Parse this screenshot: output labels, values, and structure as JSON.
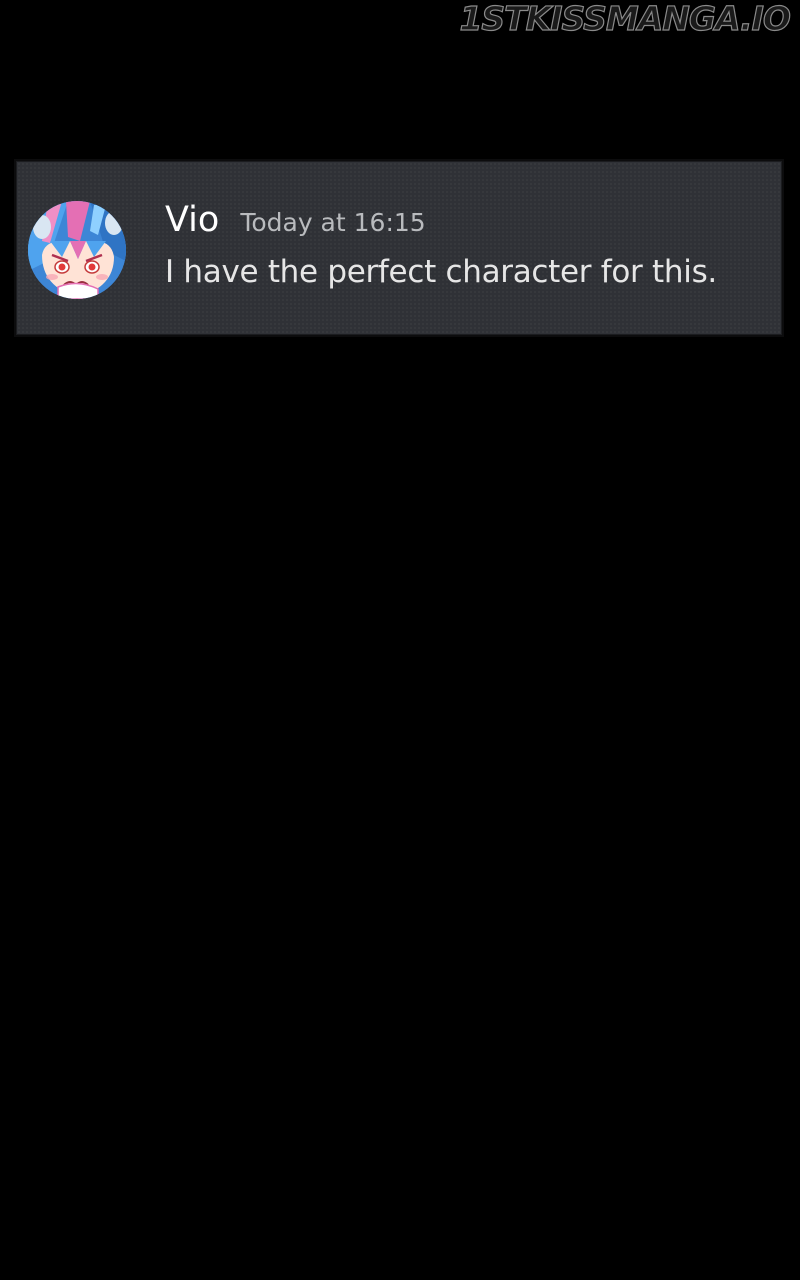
{
  "watermark": {
    "text": "1STKISSMANGA.IO"
  },
  "message": {
    "author": "Vio",
    "timestamp": "Today at 16:15",
    "text": "I have the perfect character for this.",
    "avatar_icon": "anime-girl-avatar-icon"
  },
  "colors": {
    "page_background": "#000000",
    "card_background": "#2f3136",
    "username": "#ffffff",
    "timestamp": "#b9bbbe",
    "message_text": "#e6e6e6"
  }
}
